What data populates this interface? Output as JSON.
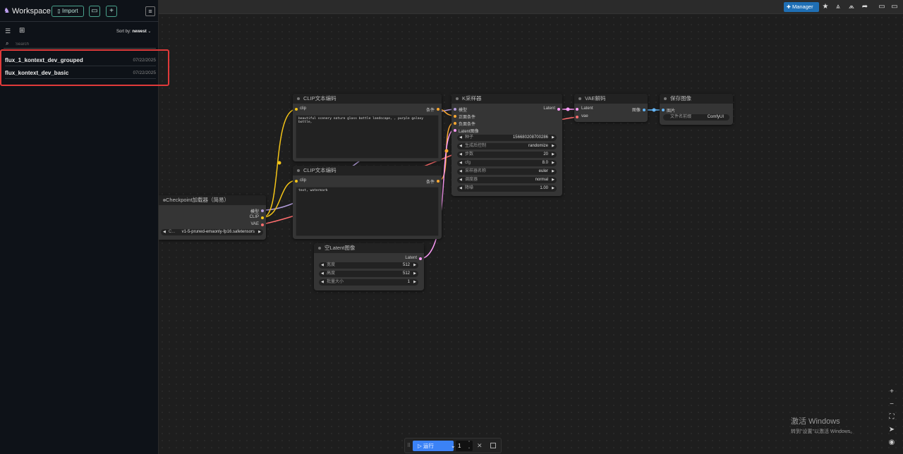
{
  "sidebar": {
    "title": "Workspace",
    "import_label": "Import",
    "sort_label": "Sort by:",
    "sort_value": "newest",
    "search_placeholder": "Search",
    "workflows": [
      {
        "name": "flux_1_kontext_dev_grouped",
        "date": "07/22/2025"
      },
      {
        "name": "flux_kontext_dev_basic",
        "date": "07/22/2025"
      }
    ]
  },
  "topbar": {
    "manager_label": "Manager"
  },
  "nodes": {
    "clip_pos": {
      "title": "CLIP文本编码",
      "input_clip": "clip",
      "output_cond": "条件",
      "text": "beautiful scenery nature glass bottle landscape, , purple galaxy bottle,"
    },
    "clip_neg": {
      "title": "CLIP文本编码",
      "input_clip": "clip",
      "output_cond": "条件",
      "text": "text, watermark"
    },
    "checkpoint": {
      "title": "Checkpoint加载器（简易）",
      "out_model": "模型",
      "out_clip": "CLIP",
      "out_vae": "VAE",
      "ckpt_label": "C...",
      "ckpt_value": "v1-5-pruned-emaonly-fp16.safetensors"
    },
    "ksampler": {
      "title": "K采样器",
      "in_model": "模型",
      "in_pos": "正面条件",
      "in_neg": "负面条件",
      "in_latent": "Latent图像",
      "out_latent": "Latent",
      "widgets": [
        {
          "label": "种子",
          "value": "156680208700286"
        },
        {
          "label": "生成后控制",
          "value": "randomize"
        },
        {
          "label": "步数",
          "value": "20"
        },
        {
          "label": "cfg",
          "value": "8.0"
        },
        {
          "label": "采样器名称",
          "value": "euler"
        },
        {
          "label": "调度器",
          "value": "normal"
        },
        {
          "label": "降噪",
          "value": "1.00"
        }
      ]
    },
    "vae_decode": {
      "title": "VAE解码",
      "in_latent": "Latent",
      "in_vae": "vae",
      "out_image": "图像"
    },
    "save_image": {
      "title": "保存图像",
      "in_images": "图片",
      "prefix_label": "文件名前缀",
      "prefix_value": "ComfyUI"
    },
    "empty_latent": {
      "title": "空Latent图像",
      "out_latent": "Latent",
      "widgets": [
        {
          "label": "宽度",
          "value": "512"
        },
        {
          "label": "高度",
          "value": "512"
        },
        {
          "label": "批量大小",
          "value": "1"
        }
      ]
    }
  },
  "runbar": {
    "run_label": "运行",
    "batch_count": "1"
  },
  "watermark": {
    "title": "激活 Windows",
    "subtitle": "转到\"设置\"以激活 Windows。"
  },
  "colors": {
    "accent": "#3b82f6",
    "clip_wire": "#f5c518",
    "model_wire": "#b39ddb",
    "vae_wire": "#ff6e6e",
    "latent_wire": "#ff9cf9",
    "cond_wire": "#ffa931",
    "image_wire": "#64b5f6",
    "highlight": "#e03a3a"
  }
}
